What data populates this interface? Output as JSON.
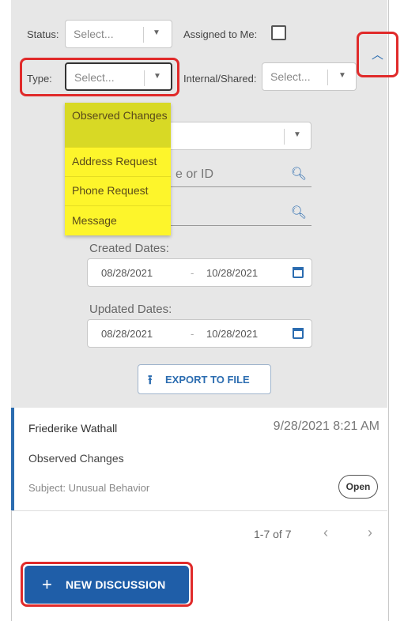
{
  "filters": {
    "status_label": "Status:",
    "status_placeholder": "Select...",
    "assigned_label": "Assigned to Me:",
    "type_label": "Type:",
    "type_placeholder": "Select...",
    "internal_label": "Internal/Shared:",
    "internal_placeholder": "Select...",
    "search_name_tail": "e or ID",
    "created_label": "Created Dates:",
    "created_from": "08/28/2021",
    "created_to": "10/28/2021",
    "updated_label": "Updated Dates:",
    "updated_from": "08/28/2021",
    "updated_to": "10/28/2021",
    "date_separator": "-",
    "export_label": "EXPORT TO FILE"
  },
  "type_dropdown": {
    "options": [
      "Observed Changes",
      "Address Request",
      "Phone Request",
      "Message"
    ],
    "highlighted": "Observed Changes"
  },
  "discussion": {
    "name": "Friederike Wathall",
    "datetime": "9/28/2021 8:21 AM",
    "type": "Observed Changes",
    "subject": "Subject: Unusual Behavior",
    "status_button": "Open"
  },
  "pagination": {
    "range": "1-7 of 7",
    "prev": "‹",
    "next": "›"
  },
  "new_discussion_label": "NEW DISCUSSION",
  "colors": {
    "accent": "#1f5ea8",
    "highlight": "#fdf52b",
    "callout": "#e02a2a"
  },
  "icons": {
    "collapse": "chevron-up-icon",
    "search": "search-icon",
    "calendar": "calendar-icon",
    "export": "upload-icon",
    "add": "plus-icon"
  }
}
